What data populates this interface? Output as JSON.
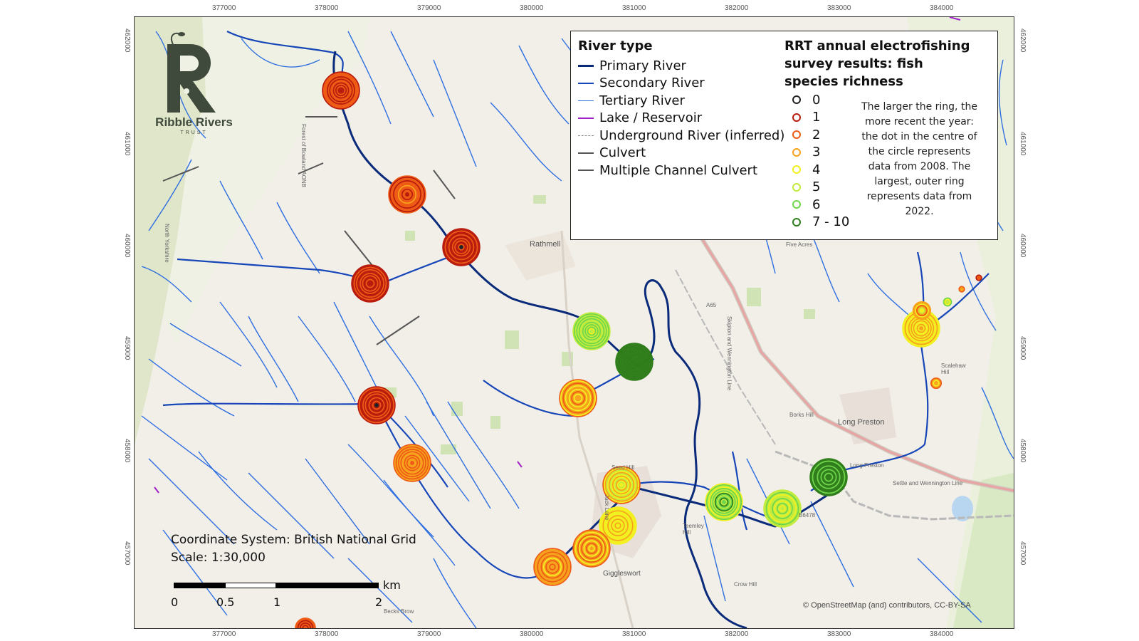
{
  "map": {
    "coordinate_system_label": "Coordinate System: British National Grid",
    "scale_label": "Scale: 1:30,000",
    "attribution": "© OpenStreetMap (and) contributors, CC-BY-SA",
    "x_ticks": [
      "377000",
      "378000",
      "379000",
      "380000",
      "381000",
      "382000",
      "383000",
      "384000"
    ],
    "y_ticks": [
      "462000",
      "461000",
      "460000",
      "459000",
      "458000",
      "457000"
    ],
    "scale_bar": {
      "labels": [
        "0",
        "0.5",
        "1",
        "2"
      ],
      "unit": "km"
    },
    "place_labels": [
      "Rathmell",
      "Five Acres",
      "Long Preston",
      "Seed Hill",
      "Jack Lane",
      "Giggleswort",
      "Teemley Hill",
      "Borks Hill",
      "Crow Hill",
      "Becks Brow",
      "Scalehaw Hill",
      "A65",
      "B6478",
      "North Yorkshire",
      "Forest of Bowland AONB",
      "Skipton and Wennington Line",
      "Settle and Wennington Line",
      "Long Preston"
    ]
  },
  "logo": {
    "name": "Ribble Rivers",
    "sub": "TRUST"
  },
  "legend": {
    "river_type_title": "River type",
    "river_types": [
      {
        "label": "Primary River",
        "color": "#0a2a7a",
        "style": "solid",
        "weight": 3
      },
      {
        "label": "Secondary River",
        "color": "#1646b8",
        "style": "solid",
        "weight": 2.5
      },
      {
        "label": "Tertiary River",
        "color": "#2f6fe0",
        "style": "solid",
        "weight": 1.5
      },
      {
        "label": "Lake / Reservoir",
        "color": "#a020c8",
        "style": "solid",
        "weight": 2
      },
      {
        "label": "Underground River (inferred)",
        "color": "#8a8a8a",
        "style": "dashed",
        "weight": 1
      },
      {
        "label": "Culvert",
        "color": "#555555",
        "style": "solid",
        "weight": 2
      },
      {
        "label": "Multiple Channel Culvert",
        "color": "#555555",
        "style": "solid",
        "weight": 2.5
      }
    ],
    "richness_title": "RRT annual electrofishing survey results: fish species richness",
    "richness_classes": [
      {
        "label": "0",
        "color": "#222222"
      },
      {
        "label": "1",
        "color": "#b81a0c"
      },
      {
        "label": "2",
        "color": "#ee5a14"
      },
      {
        "label": "3",
        "color": "#f7a21b"
      },
      {
        "label": "4",
        "color": "#f2f01e"
      },
      {
        "label": "5",
        "color": "#c3ec3c"
      },
      {
        "label": "6",
        "color": "#6ed64a"
      },
      {
        "label": "7 - 10",
        "color": "#2f7d1a"
      }
    ],
    "note": "The larger the ring, the more recent the year: the dot in the centre of the circle represents data from 2008. The largest, outer ring represents data from 2022."
  }
}
